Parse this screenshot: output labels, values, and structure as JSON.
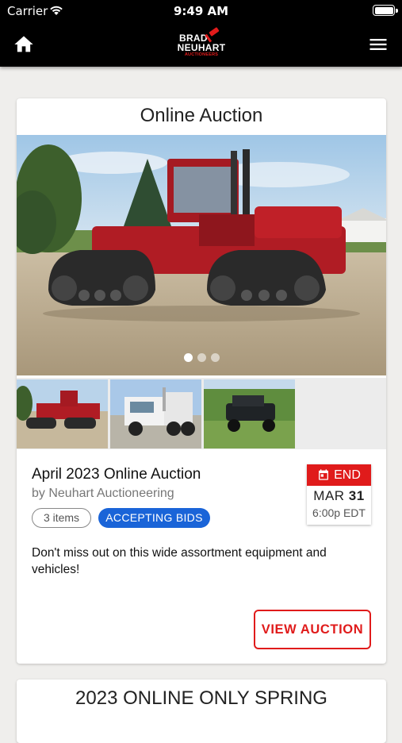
{
  "status_bar": {
    "carrier": "Carrier",
    "time": "9:49 AM"
  },
  "nav": {
    "home_icon": "home-icon",
    "menu_icon": "hamburger-menu-icon",
    "logo": {
      "line1": "BRAD",
      "line2": "NEUHART",
      "line3": "AUCTIONEERS"
    }
  },
  "auction_card": {
    "heading": "Online Auction",
    "carousel": {
      "slides": 3,
      "active_slide": 1
    },
    "thumbnails": [
      "red-tracked-tractor",
      "white-semi-truck",
      "vintage-black-car"
    ],
    "title": "April 2023 Online Auction",
    "byline": "by Neuhart Auctioneering",
    "items_count": "3 items",
    "status": "ACCEPTING BIDS",
    "end_label": "END",
    "end_month": "MAR",
    "end_day": "31",
    "end_time": "6:00p EDT",
    "description": "Don't miss out on this wide assortment equipment and vehicles!",
    "view_button": "VIEW AUCTION"
  },
  "next_card": {
    "heading": "2023 ONLINE ONLY SPRING"
  },
  "colors": {
    "accent_red": "#e01b1b",
    "status_blue": "#1a64d8",
    "nav_bg": "#000000",
    "page_bg": "#efeeec"
  }
}
